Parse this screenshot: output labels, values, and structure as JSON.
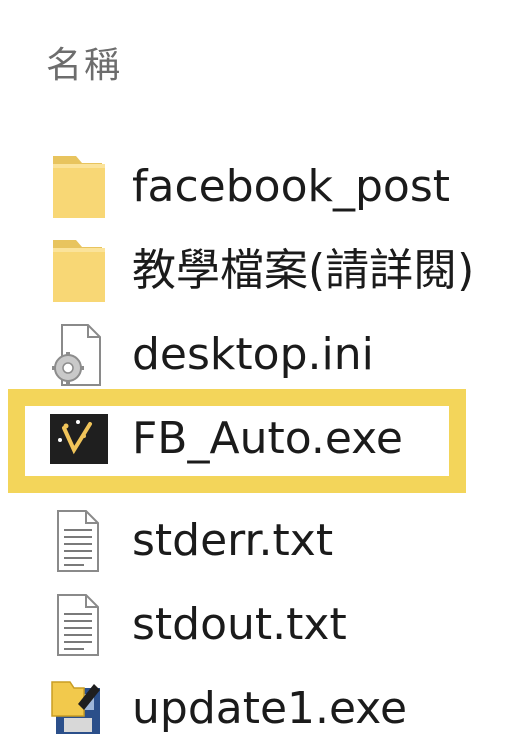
{
  "header": {
    "name_column_label": "名稱"
  },
  "files": [
    {
      "name": "facebook_post",
      "icon": "folder-icon"
    },
    {
      "name": "教學檔案(請詳閱)",
      "icon": "folder-icon"
    },
    {
      "name": "desktop.ini",
      "icon": "settings-file-icon"
    },
    {
      "name": "FB_Auto.exe",
      "icon": "fb-auto-app-icon",
      "highlighted": true
    },
    {
      "name": "stderr.txt",
      "icon": "text-file-icon"
    },
    {
      "name": "stdout.txt",
      "icon": "text-file-icon"
    },
    {
      "name": "update1.exe",
      "icon": "installer-icon"
    }
  ],
  "colors": {
    "highlight": "#f3d55a",
    "folder": "#f8d775",
    "header_text": "#6d6d6d"
  }
}
